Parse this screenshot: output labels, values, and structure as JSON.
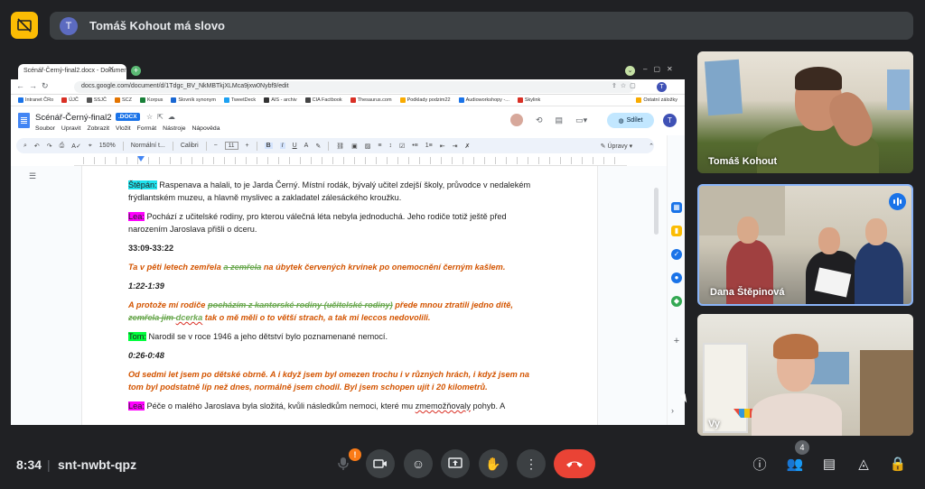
{
  "presenter": {
    "avatar_letter": "T",
    "status": "Tomáš Kohout má slovo"
  },
  "browser": {
    "tab_title": "Scénář-Černý-final2.docx - Dokumenty",
    "url": "docs.google.com/document/d/1Tdgc_BV_NkMBTkjXLMca9jxw0Nybf9/edit",
    "profile_letter": "T",
    "bookmarks": [
      "Intranet ČRo",
      "ÚJČ",
      "SSJČ",
      "SCZ",
      "Korpus",
      "Slovník synonym",
      "TweetDeck",
      "AIS - archiv",
      "CIA Factbook",
      "Thesaurus.com",
      "Podklady podzim22",
      "Audioworkshopy -...",
      "Skylink",
      "Ostatní záložky"
    ]
  },
  "docs": {
    "title": "Scénář-Černý-final2",
    "badge": ".DOCX",
    "menu": [
      "Soubor",
      "Upravit",
      "Zobrazit",
      "Vložit",
      "Formát",
      "Nástroje",
      "Nápověda"
    ],
    "share_label": "Sdílet",
    "avatar_letter": "T",
    "toolbar": {
      "zoom": "150%",
      "style": "Normální t...",
      "font": "Calibri",
      "size": "11",
      "edit_mode": "Úpravy"
    }
  },
  "content": {
    "p1_name": "Štěpán:",
    "p1_text": " Raspenava a halali, to je Jarda Černý. Místní rodák, bývalý učitel zdejší školy, průvodce v nedalekém frýdlantském muzeu, a hlavně myslivec a zakladatel zálesáckého kroužku.",
    "p2_name": "Lea:",
    "p2_text": " Pochází z učitelské rodiny, pro kterou válečná léta nebyla jednoduchá. Jeho rodiče totiž ještě před narozením Jaroslava přišli o dceru.",
    "t1": "33:09-33:22",
    "q1_a": "Ta v pěti letech zemřela ",
    "q1_strike": "a zemřela",
    "q1_b": " na úbytek červených krvinek po onemocnění černým kašlem.",
    "t2": "1:22-1:39",
    "q2_a": "A protože mí rodiče ",
    "q2_strike1": "pocházím z kantorské rodiny (učitelské rodiny)",
    "q2_b": " přede mnou ztratili jedno dítě, ",
    "q2_strike2a": "zemřela jim ",
    "q2_strike2b": "dcerka",
    "q2_c": " tak o mě měli o to větší strach, a tak mi leccos nedovolili.",
    "p3_name": "Tom:",
    "p3_text": " Narodil se v roce 1946 a jeho dětství bylo poznamenané nemocí.",
    "t3": "0:26-0:48",
    "q3": "Od sedmi let jsem po dětské obrně. A i když jsem byl omezen trochu i v různých hrách, i když jsem na tom byl podstatně líp než dnes, normálně jsem chodil. Byl jsem schopen ujít i 20 kilometrů.",
    "p4_name": "Lea:",
    "p4_a": " Péče o malého Jaroslava byla složitá, kvůli následkům nemoci, které mu ",
    "p4_squig": "zmemožňovaly",
    "p4_b": " pohyb. A"
  },
  "participants": [
    {
      "name": "Tomáš Kohout"
    },
    {
      "name": "Dana Štěpinová"
    },
    {
      "name": "Vy"
    }
  ],
  "meeting": {
    "time": "8:34",
    "separator": "|",
    "code": "snt-nwbt-qpz",
    "mic_badge": "!",
    "people_count": "4"
  },
  "colors": {
    "background": "#202124",
    "accent": "#8ab4f8",
    "end_call": "#ea4335",
    "presenting": "#fbbc04",
    "script_orange": "#d35400"
  }
}
